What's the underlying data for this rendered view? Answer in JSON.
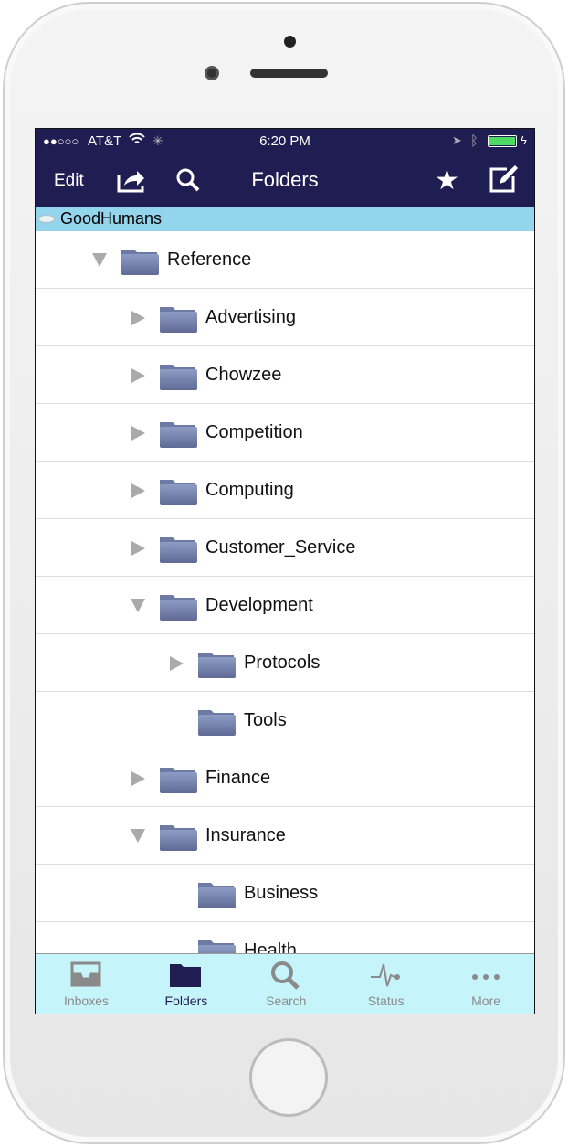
{
  "status": {
    "carrier": "AT&T",
    "time": "6:20 PM",
    "signal_dots": "●●○○○",
    "battery_color": "#4cd964"
  },
  "nav": {
    "edit": "Edit",
    "title": "Folders",
    "icons": [
      "share-icon",
      "search-icon",
      "star-icon",
      "compose-icon"
    ]
  },
  "account": {
    "name": "GoodHumans"
  },
  "folders": [
    {
      "label": "Reference",
      "level": 0,
      "state": "expanded"
    },
    {
      "label": "Advertising",
      "level": 1,
      "state": "collapsed"
    },
    {
      "label": "Chowzee",
      "level": 1,
      "state": "collapsed"
    },
    {
      "label": "Competition",
      "level": 1,
      "state": "collapsed"
    },
    {
      "label": "Computing",
      "level": 1,
      "state": "collapsed"
    },
    {
      "label": "Customer_Service",
      "level": 1,
      "state": "collapsed"
    },
    {
      "label": "Development",
      "level": 1,
      "state": "expanded"
    },
    {
      "label": "Protocols",
      "level": 2,
      "state": "collapsed"
    },
    {
      "label": "Tools",
      "level": 2,
      "state": "none"
    },
    {
      "label": "Finance",
      "level": 1,
      "state": "collapsed"
    },
    {
      "label": "Insurance",
      "level": 1,
      "state": "expanded"
    },
    {
      "label": "Business",
      "level": 2,
      "state": "none"
    },
    {
      "label": "Health",
      "level": 2,
      "state": "none"
    }
  ],
  "tabs": [
    {
      "label": "Inboxes",
      "icon": "inbox-icon",
      "active": false
    },
    {
      "label": "Folders",
      "icon": "folder-icon",
      "active": true
    },
    {
      "label": "Search",
      "icon": "search-icon",
      "active": false
    },
    {
      "label": "Status",
      "icon": "pulse-icon",
      "active": false
    },
    {
      "label": "More",
      "icon": "more-icon",
      "active": false
    }
  ],
  "colors": {
    "nav": "#1f1d52",
    "account_bar": "#93d5ec",
    "tabbar": "#c6f4fb",
    "folder": "#6d7aa3"
  }
}
